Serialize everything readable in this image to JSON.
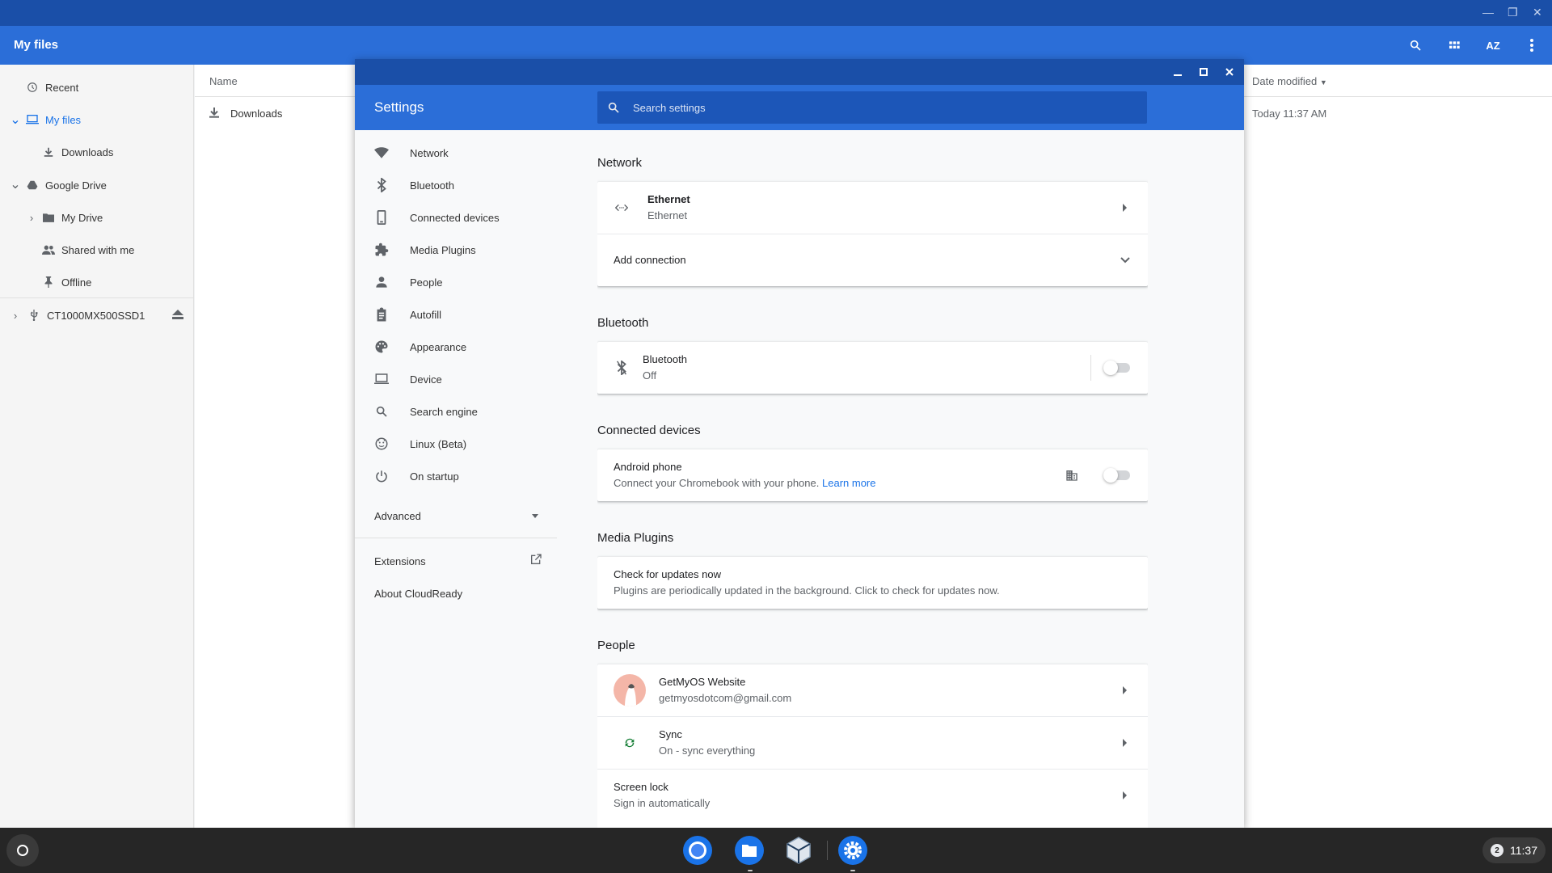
{
  "files": {
    "header_title": "My files",
    "columns": {
      "name": "Name",
      "date": "Date modified"
    },
    "rows": [
      {
        "name": "Downloads",
        "date": "Today 11:37 AM"
      }
    ],
    "sidebar": {
      "recent": "Recent",
      "my_files": "My files",
      "downloads": "Downloads",
      "google_drive": "Google Drive",
      "my_drive": "My Drive",
      "shared": "Shared with me",
      "offline": "Offline",
      "device": "CT1000MX500SSD1"
    },
    "sort_label": "AZ"
  },
  "settings": {
    "title": "Settings",
    "search_placeholder": "Search settings",
    "menu": [
      {
        "label": "Network",
        "icon": "wifi-icon"
      },
      {
        "label": "Bluetooth",
        "icon": "bluetooth-icon"
      },
      {
        "label": "Connected devices",
        "icon": "phone-icon"
      },
      {
        "label": "Media Plugins",
        "icon": "puzzle-icon"
      },
      {
        "label": "People",
        "icon": "person-icon"
      },
      {
        "label": "Autofill",
        "icon": "clipboard-icon"
      },
      {
        "label": "Appearance",
        "icon": "palette-icon"
      },
      {
        "label": "Device",
        "icon": "laptop-icon"
      },
      {
        "label": "Search engine",
        "icon": "search-icon"
      },
      {
        "label": "Linux (Beta)",
        "icon": "linux-icon"
      },
      {
        "label": "On startup",
        "icon": "power-icon"
      }
    ],
    "advanced": "Advanced",
    "extensions": "Extensions",
    "about": "About CloudReady",
    "sections": {
      "network": {
        "title": "Network",
        "ethernet_title": "Ethernet",
        "ethernet_sub": "Ethernet",
        "add_connection": "Add connection"
      },
      "bluetooth": {
        "title": "Bluetooth",
        "row_title": "Bluetooth",
        "row_sub": "Off"
      },
      "connected": {
        "title": "Connected devices",
        "row_title": "Android phone",
        "row_sub": "Connect your Chromebook with your phone.",
        "learn_more": "Learn more"
      },
      "media": {
        "title": "Media Plugins",
        "row_title": "Check for updates now",
        "row_sub": "Plugins are periodically updated in the background. Click to check for updates now."
      },
      "people": {
        "title": "People",
        "account_name": "GetMyOS Website",
        "account_email": "getmyosdotcom@gmail.com",
        "sync_title": "Sync",
        "sync_sub": "On - sync everything",
        "lock_title": "Screen lock",
        "lock_sub": "Sign in automatically"
      }
    }
  },
  "shelf": {
    "notification_count": "2",
    "time": "11:37"
  },
  "colors": {
    "titlebar": "#1a4fa8",
    "header": "#2b6ed8",
    "accent": "#1a73e8"
  }
}
